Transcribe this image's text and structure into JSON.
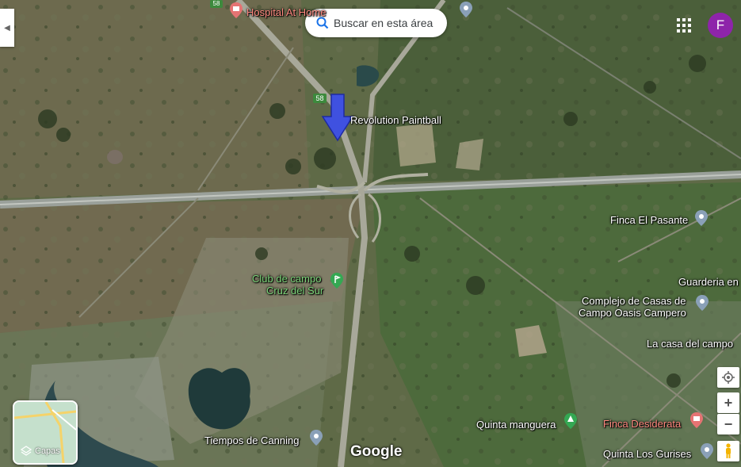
{
  "search": {
    "placeholder": "Buscar en esta área"
  },
  "account": {
    "initial": "F",
    "color": "#8e24aa"
  },
  "layers": {
    "label": "Capas"
  },
  "branding": {
    "logo": "Google"
  },
  "route_shields": [
    "58",
    "58"
  ],
  "places": [
    {
      "id": "hospital",
      "name": "Hospital At Home",
      "type": "hospital"
    },
    {
      "id": "revolution",
      "name": "Revolution Paintball",
      "type": "default"
    },
    {
      "id": "finca-pasante",
      "name": "Finca El Pasante",
      "type": "default"
    },
    {
      "id": "club-line1",
      "name": "Club de campo",
      "type": "park"
    },
    {
      "id": "club-line2",
      "name": "Cruz del Sur",
      "type": "park"
    },
    {
      "id": "guarderia",
      "name": "Guarderia en",
      "type": "default"
    },
    {
      "id": "complejo-line1",
      "name": "Complejo de Casas de",
      "type": "default"
    },
    {
      "id": "complejo-line2",
      "name": "Campo Oasis Campero",
      "type": "default"
    },
    {
      "id": "casa-campo",
      "name": "La casa del campo",
      "type": "default"
    },
    {
      "id": "quinta-manguera",
      "name": "Quinta manguera",
      "type": "park"
    },
    {
      "id": "finca-desiderata",
      "name": "Finca Desiderata",
      "type": "hospital"
    },
    {
      "id": "tiempos",
      "name": "Tiempos de Canning",
      "type": "default"
    },
    {
      "id": "quinta-gurises",
      "name": "Quinta Los Gurises",
      "type": "default"
    }
  ],
  "controls": {
    "zoom_in": "+",
    "zoom_out": "−"
  },
  "colors": {
    "marker_arrow": "#3f51e0",
    "pin_default": "#8aa0b8",
    "pin_park": "#34a853",
    "pin_red": "#e57373"
  }
}
